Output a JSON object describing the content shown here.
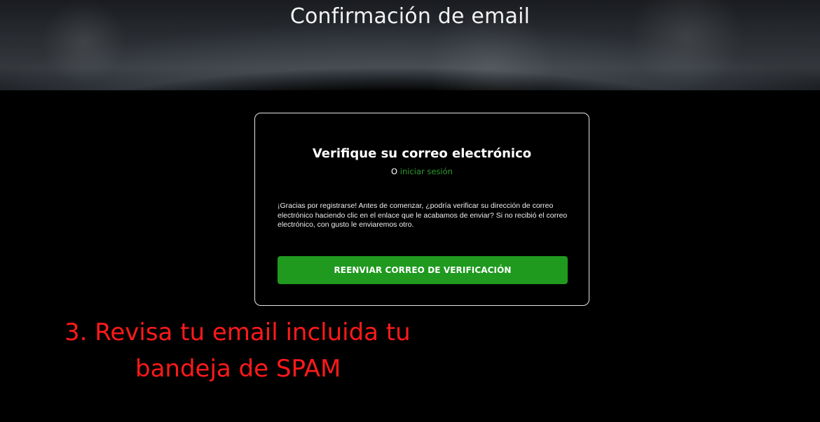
{
  "header": {
    "title": "Confirmación de email"
  },
  "card": {
    "title": "Verifique su correo electrónico",
    "or_text": "O",
    "login_link": "iniciar sesión",
    "message": "¡Gracias por registrarse! Antes de comenzar, ¿podría verificar su dirección de correo electrónico haciendo clic en el enlace que le acabamos de enviar? Si no recibió el correo electrónico, con gusto le enviaremos otro.",
    "resend_button": "REENVIAR CORREO DE VERIFICACIÓN"
  },
  "annotation": {
    "line1": "3. Revisa tu email incluida tu",
    "line2": "bandeja de SPAM"
  },
  "colors": {
    "accent": "#1f9a1f",
    "link": "#2e9b2e",
    "annotation": "#ff1a1a",
    "background": "#000000"
  }
}
